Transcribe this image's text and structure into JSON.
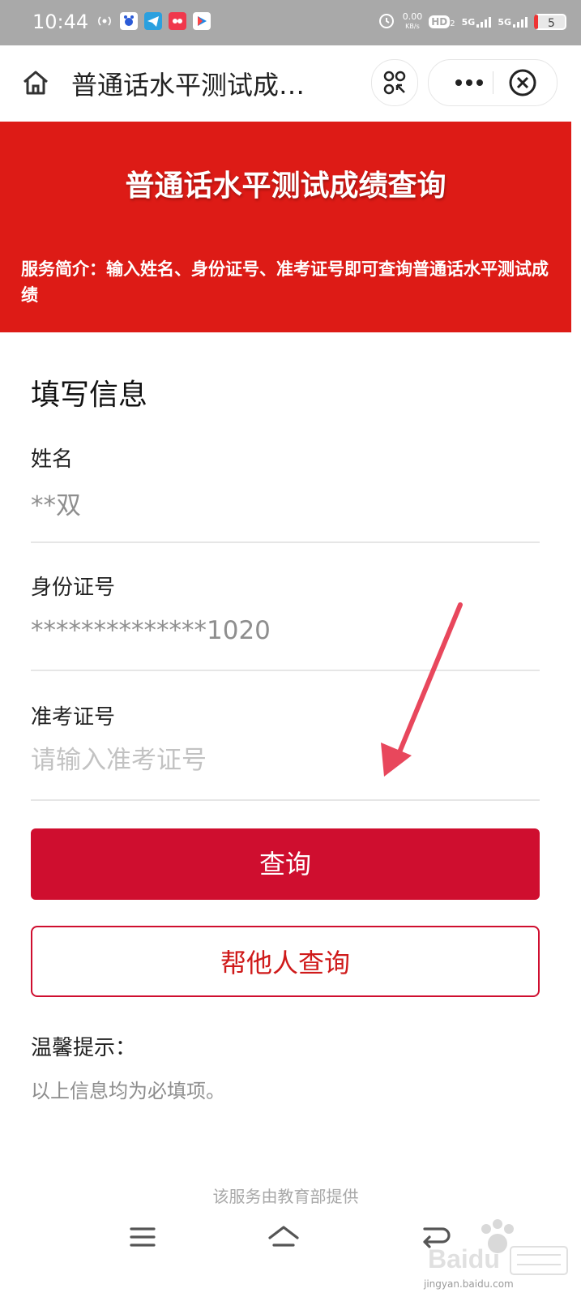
{
  "status_bar": {
    "time": "10:44",
    "net_speed": "0.00",
    "net_unit": "KB/s",
    "hd": "HD",
    "hd_sub": "2",
    "sig1": "5G",
    "sig2": "5G",
    "battery": "5"
  },
  "nav": {
    "title": "普通话水平测试成…"
  },
  "banner": {
    "title": "普通话水平测试成绩查询",
    "intro": "服务简介：输入姓名、身份证号、准考证号即可查询普通话水平测试成绩",
    "background": "#dd1b16"
  },
  "form": {
    "section_title": "填写信息",
    "fields": [
      {
        "label": "姓名",
        "value": "**双",
        "placeholder": ""
      },
      {
        "label": "身份证号",
        "value": "**************1020",
        "placeholder": ""
      },
      {
        "label": "准考证号",
        "value": "",
        "placeholder": "请输入准考证号"
      }
    ],
    "query_button": "查询",
    "other_query_button": "帮他人查询",
    "tip_title": "温馨提示：",
    "tip_text": "以上信息均为必填项。"
  },
  "footer": {
    "text": "该服务由教育部提供"
  },
  "watermark": {
    "text": "jingyan.baidu.com"
  },
  "colors": {
    "primary": "#cf0e2f",
    "banner": "#dd1b16",
    "arrow": "#e8475c"
  }
}
